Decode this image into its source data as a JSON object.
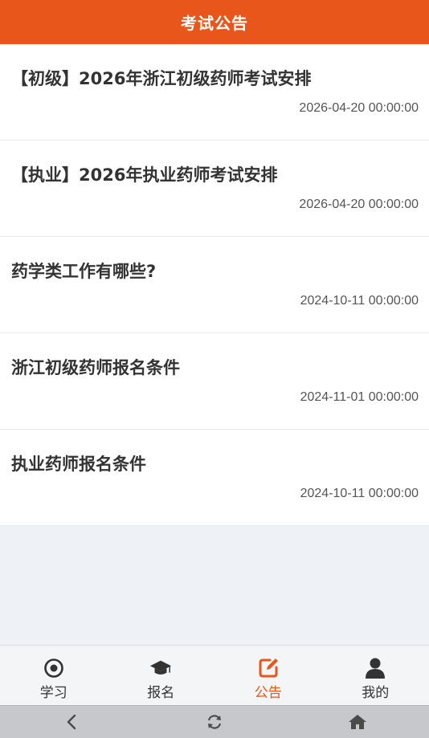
{
  "header": {
    "title": "考试公告"
  },
  "notices": [
    {
      "title": "【初级】2026年浙江初级药师考试安排",
      "date": "2026-04-20 00:00:00"
    },
    {
      "title": "【执业】2026年执业药师考试安排",
      "date": "2026-04-20 00:00:00"
    },
    {
      "title": "药学类工作有哪些?",
      "date": "2024-10-11 00:00:00"
    },
    {
      "title": "浙江初级药师报名条件",
      "date": "2024-11-01 00:00:00"
    },
    {
      "title": "执业药师报名条件",
      "date": "2024-10-11 00:00:00"
    }
  ],
  "tabs": [
    {
      "label": "学习",
      "icon": "target-icon"
    },
    {
      "label": "报名",
      "icon": "graduation-cap-icon"
    },
    {
      "label": "公告",
      "icon": "edit-icon",
      "active": true
    },
    {
      "label": "我的",
      "icon": "user-icon"
    }
  ],
  "system_nav": [
    "back-icon",
    "refresh-icon",
    "home-icon"
  ],
  "colors": {
    "accent": "#e8561c",
    "background": "#eef2f6"
  }
}
